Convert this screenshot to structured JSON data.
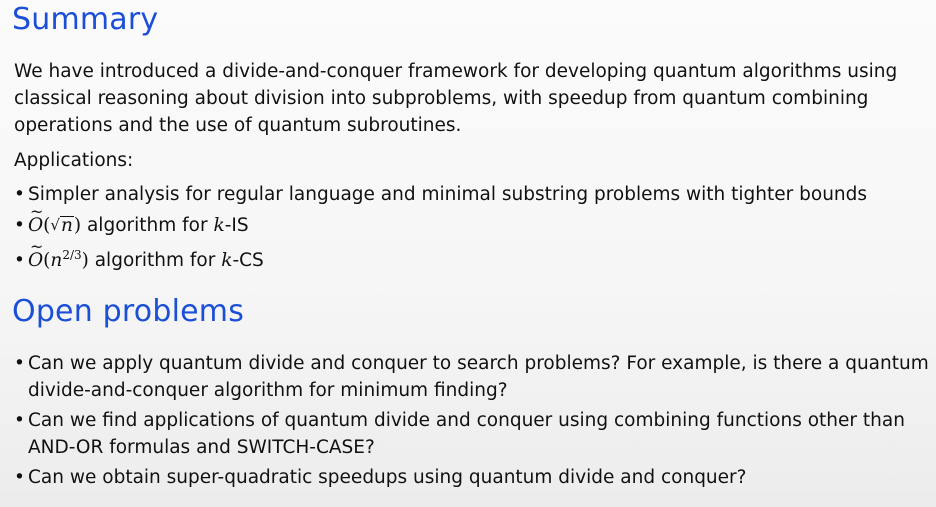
{
  "summary": {
    "heading": "Summary",
    "paragraph": "We have introduced a divide-and-conquer framework for developing quantum algorithms using classical reasoning about division into subproblems, with speedup from quantum combining operations and the use of quantum subroutines.",
    "applications_title": "Applications:",
    "applications": [
      {
        "text": "Simpler analysis for regular language and minimal substring problems with tighter bounds"
      },
      {
        "math_prefix": "Õ(√n)",
        "text": " algorithm for ",
        "var": "k",
        "suffix": "-IS"
      },
      {
        "math_prefix": "Õ(n^(2/3))",
        "text": " algorithm for ",
        "var": "k",
        "suffix": "-CS"
      }
    ]
  },
  "open_problems": {
    "heading": "Open problems",
    "items": [
      "Can we apply quantum divide and conquer to search problems? For example, is there a quantum divide-and-conquer algorithm for minimum finding?",
      "Can we find applications of quantum divide and conquer using combining functions other than AND-OR formulas and SWITCH-CASE?",
      "Can we obtain super-quadratic speedups using quantum divide and conquer?"
    ]
  }
}
